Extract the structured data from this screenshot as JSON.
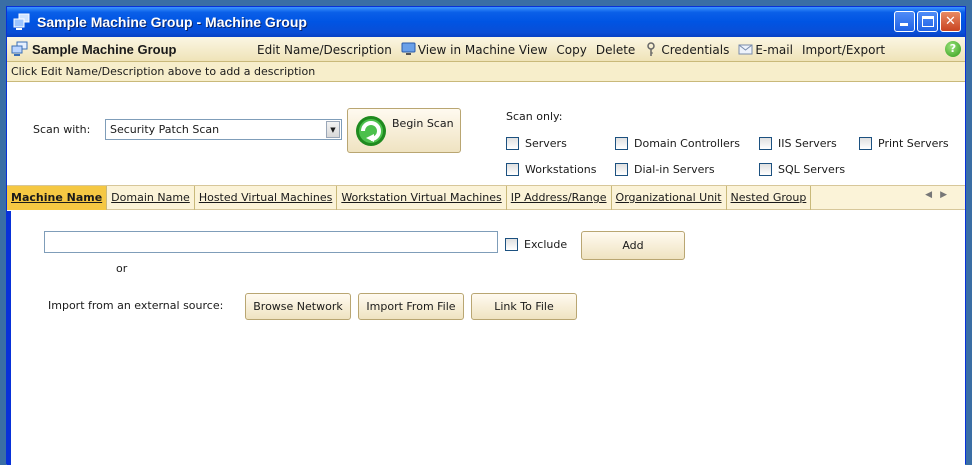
{
  "window": {
    "title": "Sample Machine Group - Machine Group"
  },
  "menubar": {
    "group_name": "Sample Machine Group",
    "items": [
      {
        "label": "Edit Name/Description",
        "icon": ""
      },
      {
        "label": "View in Machine View",
        "icon": "monitor-icon"
      },
      {
        "label": "Copy",
        "icon": ""
      },
      {
        "label": "Delete",
        "icon": ""
      },
      {
        "label": "Credentials",
        "icon": "key-icon"
      },
      {
        "label": "E-mail",
        "icon": "email-icon"
      },
      {
        "label": "Import/Export",
        "icon": ""
      }
    ],
    "help_glyph": "?"
  },
  "description": "Click Edit Name/Description above to add a description",
  "scan": {
    "scan_with_label": "Scan with:",
    "selected_scan": "Security Patch Scan",
    "begin_label": "Begin Scan",
    "scan_only_label": "Scan only:",
    "options": [
      {
        "label": "Servers",
        "checked": false
      },
      {
        "label": "Domain Controllers",
        "checked": false
      },
      {
        "label": "IIS Servers",
        "checked": false
      },
      {
        "label": "Print Servers",
        "checked": false
      },
      {
        "label": "Workstations",
        "checked": false
      },
      {
        "label": "Dial-in Servers",
        "checked": false
      },
      {
        "label": "SQL Servers",
        "checked": false
      }
    ]
  },
  "tabs": [
    {
      "label": "Machine Name",
      "active": true
    },
    {
      "label": "Domain Name"
    },
    {
      "label": "Hosted Virtual Machines"
    },
    {
      "label": "Workstation Virtual Machines"
    },
    {
      "label": "IP Address/Range"
    },
    {
      "label": "Organizational Unit"
    },
    {
      "label": "Nested Group"
    }
  ],
  "content": {
    "machine_input_value": "",
    "exclude_label": "Exclude",
    "add_label": "Add",
    "or_label": "or",
    "import_label": "Import from an external source:",
    "browse_label": "Browse Network",
    "import_file_label": "Import From File",
    "link_file_label": "Link To File"
  },
  "colors": {
    "title_bar": "#0054e3",
    "menubar": "#efe3b8",
    "active_tab": "#f5c843"
  }
}
